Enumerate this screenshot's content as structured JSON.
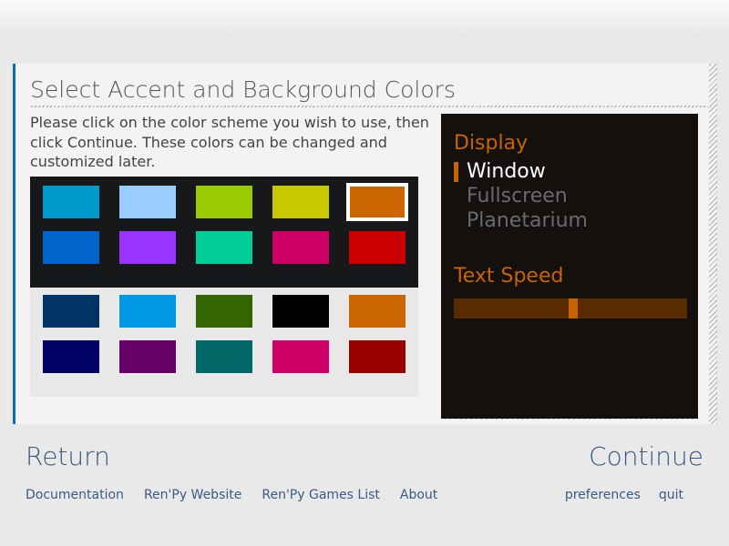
{
  "title": "Select Accent and Background Colors",
  "description": "Please click on the color scheme you wish to use, then click Continue. These colors can be changed and customized later.",
  "colors": {
    "dark_row1": [
      "#0099cc",
      "#99ccff",
      "#99cc00",
      "#c8c800",
      "#cc6600"
    ],
    "dark_row2": [
      "#0066cc",
      "#9933ff",
      "#00cc99",
      "#cc0066",
      "#cc0000"
    ],
    "light_row1": [
      "#003366",
      "#0099e6",
      "#336600",
      "#000000",
      "#cc6600"
    ],
    "light_row2": [
      "#000066",
      "#660066",
      "#006666",
      "#cc0066",
      "#990000"
    ]
  },
  "selected_color_index": {
    "group": "dark_row1",
    "index": 4
  },
  "preview": {
    "display_heading": "Display",
    "display_options": [
      "Window",
      "Fullscreen",
      "Planetarium"
    ],
    "display_selected": 0,
    "textspeed_heading": "Text Speed",
    "slider_value": 0.5,
    "accent": "#c86400",
    "background": "#14100d"
  },
  "nav": {
    "return": "Return",
    "continue": "Continue"
  },
  "footer_links_left": [
    "Documentation",
    "Ren'Py Website",
    "Ren'Py Games List",
    "About"
  ],
  "footer_links_right": [
    "preferences",
    "quit"
  ]
}
